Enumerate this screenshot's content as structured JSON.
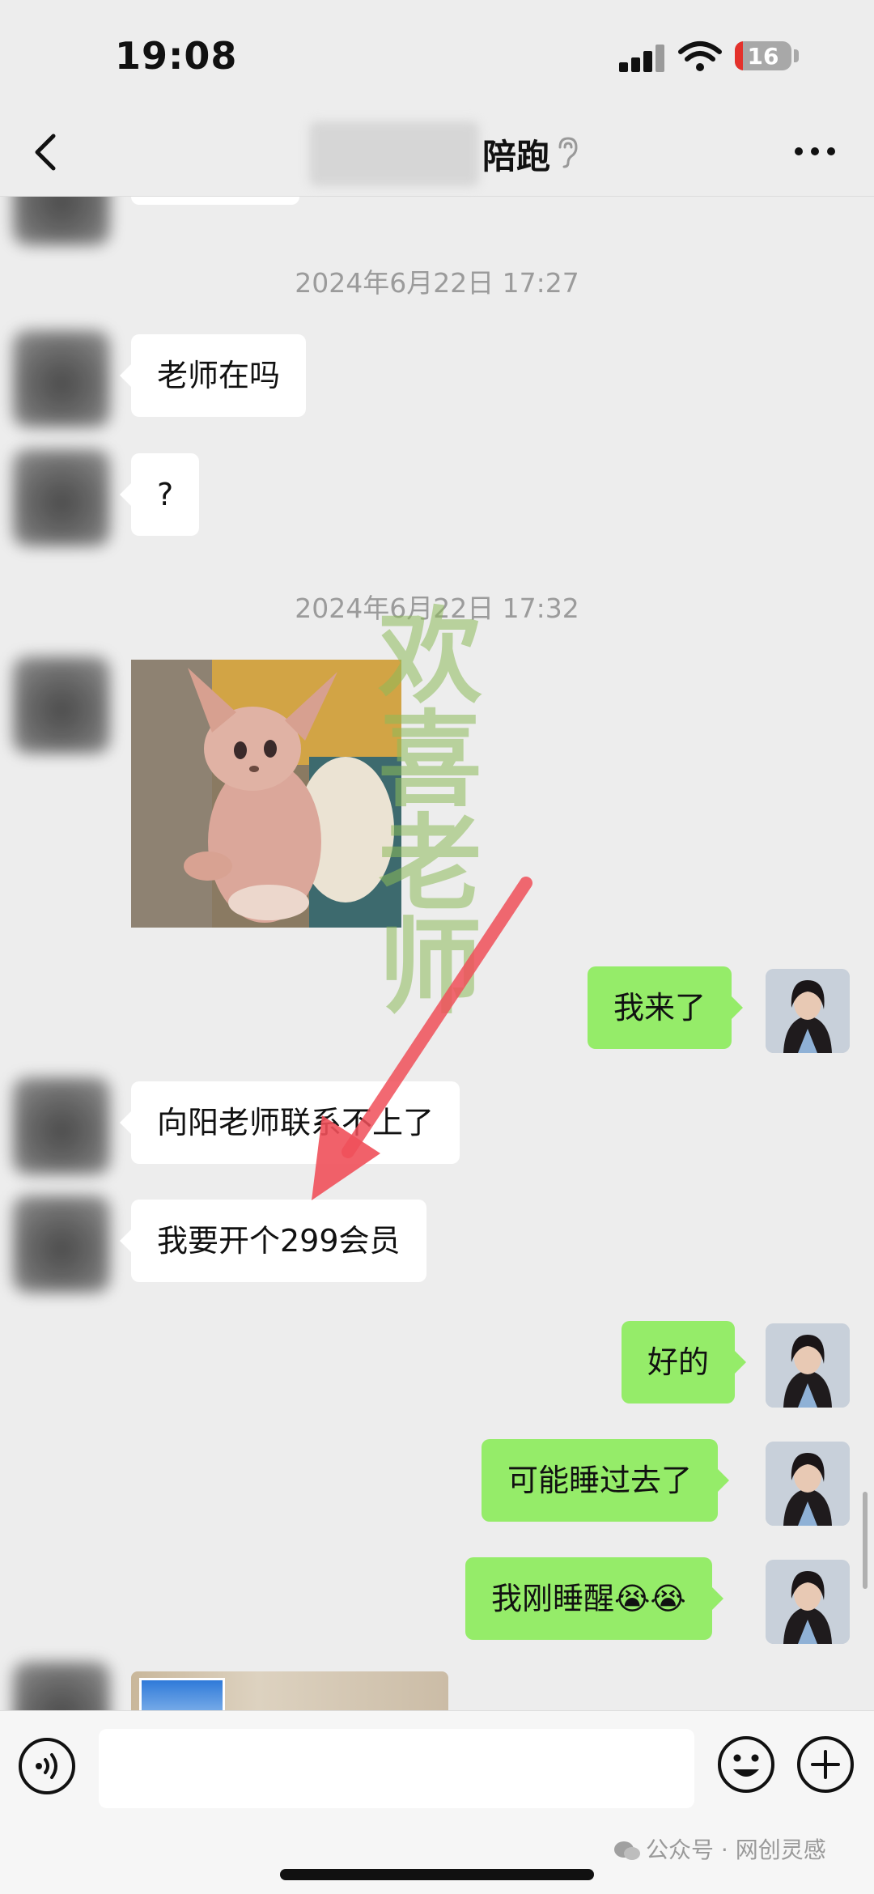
{
  "status_bar": {
    "time": "19:08",
    "battery": "16"
  },
  "nav": {
    "title": "陪跑"
  },
  "messages": {
    "ts1": "2024年6月22日 17:27",
    "m1": "老师在吗",
    "m2": "?",
    "ts2": "2024年6月22日 17:32",
    "m3": "我来了",
    "m4": "向阳老师联系不上了",
    "m5": "我要开个299会员",
    "m6": "好的",
    "m7": "可能睡过去了",
    "m8": "我刚睡醒😭😭"
  },
  "watermark": "欢喜老师",
  "footer": {
    "watermark": "公众号 · 网创灵感"
  },
  "colors": {
    "self_bubble": "#95ec69",
    "other_bubble": "#ffffff",
    "background": "#ededed",
    "arrow": "#f0505a"
  }
}
